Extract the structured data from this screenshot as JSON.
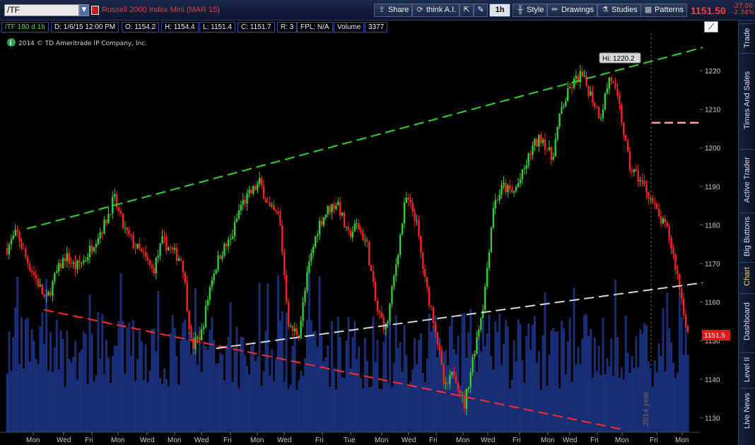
{
  "toolbar": {
    "symbol": "/TF",
    "description": "Russell 2000 Index Mini (MAR 15)",
    "share": "Share",
    "think_ai": "think A.I.",
    "timeframe": "1h",
    "style": "Style",
    "drawings": "Drawings",
    "studies": "Studies",
    "patterns": "Patterns",
    "last_price": "1151.50",
    "net_change": "-27.00",
    "pct_change": "-2.34%"
  },
  "infobar": {
    "period": "/TF 180 d 1h",
    "date": "D: 1/6/15 12:00 PM",
    "open": "O: 1154.2",
    "high": "H: 1154.4",
    "low": "L: 1151.4",
    "close": "C: 1151.7",
    "range": "R: 3",
    "fpl": "FPL: N/A",
    "volume_label": "Volume",
    "volume_value": "3377"
  },
  "chart": {
    "copyright": "2014 © TD Ameritrade IP Company, Inc.",
    "hi_label": "Hi: 1220.2",
    "year_marker": "2014 year",
    "price_tag": "1151.5",
    "colors": {
      "up": "#2fd02f",
      "down": "#ff2020",
      "volume": "#1a2f7a",
      "upper_trend": "#27d827",
      "lower_trend": "#ff2a2a",
      "mid_trend": "#d8d8d8",
      "level": "#ff9a9a"
    }
  },
  "chart_data": {
    "type": "candlestick",
    "y_ticks": [
      "1220",
      "1210",
      "1200",
      "1190",
      "1180",
      "1170",
      "1160",
      "1150",
      "1140",
      "1130"
    ],
    "y_range": [
      1127,
      1229
    ],
    "x_ticks": [
      "Mon",
      "Wed",
      "Fri",
      "Mon",
      "Wed",
      "Mon",
      "Wed",
      "Fri",
      "Mon",
      "Wed",
      "Fri",
      "Tue",
      "Mon",
      "Wed",
      "Fri",
      "Mon",
      "Wed",
      "Fri",
      "Mon",
      "Wed",
      "Fri",
      "Mon",
      "Fri",
      "Mon"
    ],
    "hi_value": 1220.2,
    "last_value": 1151.5,
    "path": [
      1174,
      1178,
      1171,
      1166,
      1160,
      1167,
      1172,
      1169,
      1171,
      1176,
      1180,
      1187,
      1179,
      1175,
      1172,
      1168,
      1176,
      1173,
      1171,
      1148,
      1152,
      1166,
      1173,
      1176,
      1185,
      1188,
      1191,
      1184,
      1182,
      1153,
      1152,
      1169,
      1180,
      1184,
      1186,
      1177,
      1180,
      1175,
      1158,
      1153,
      1170,
      1187,
      1182,
      1165,
      1154,
      1137,
      1142,
      1133,
      1147,
      1160,
      1185,
      1190,
      1188,
      1193,
      1200,
      1203,
      1197,
      1210,
      1216,
      1219,
      1214,
      1208,
      1219,
      1210,
      1195,
      1192,
      1188,
      1182,
      1178,
      1166,
      1152
    ]
  },
  "sidebar": {
    "tabs": [
      "Trade",
      "Times And Sales",
      "Active Trader",
      "Big Buttons",
      "Chart",
      "Dashboard",
      "Level II",
      "Live News"
    ]
  }
}
